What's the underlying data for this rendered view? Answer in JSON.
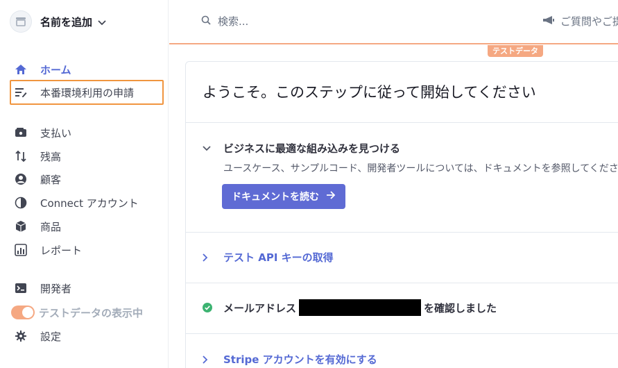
{
  "account": {
    "name": "名前を追加"
  },
  "sidebar": {
    "items": [
      {
        "label": "ホーム",
        "icon": "home-icon",
        "active": true
      },
      {
        "label": "本番環境利用の申請",
        "icon": "edit-list-icon"
      },
      {
        "label": "支払い",
        "icon": "wallet-icon"
      },
      {
        "label": "残高",
        "icon": "transfer-arrows-icon"
      },
      {
        "label": "顧客",
        "icon": "person-icon"
      },
      {
        "label": "Connect アカウント",
        "icon": "connect-globe-icon"
      },
      {
        "label": "商品",
        "icon": "box-icon"
      },
      {
        "label": "レポート",
        "icon": "report-bars-icon"
      },
      {
        "label": "開発者",
        "icon": "terminal-icon"
      },
      {
        "label": "テストデータの表示中",
        "icon": "toggle"
      },
      {
        "label": "設定",
        "icon": "gear-icon"
      }
    ]
  },
  "header": {
    "search_placeholder": "検索...",
    "help_label": "ご質問やご提"
  },
  "test_badge": "テストデータ",
  "main": {
    "title": "ようこそ。このステップに従って開始してください",
    "sections": [
      {
        "title": "ビジネスに最適な組み込みを見つける",
        "description": "ユースケース、サンプルコード、開発者ツールについては、ドキュメントを参照してください。ま",
        "button_label": "ドキュメントを読む"
      },
      {
        "title": "テスト API キーの取得"
      },
      {
        "title_prefix": "メールアドレス",
        "title_suffix": "を確認しました"
      },
      {
        "title": "Stripe アカウントを有効にする"
      }
    ]
  },
  "colors": {
    "accent": "#5469d4",
    "test_mode": "#f5a882",
    "highlight": "#f0953f",
    "success": "#3cb371"
  }
}
